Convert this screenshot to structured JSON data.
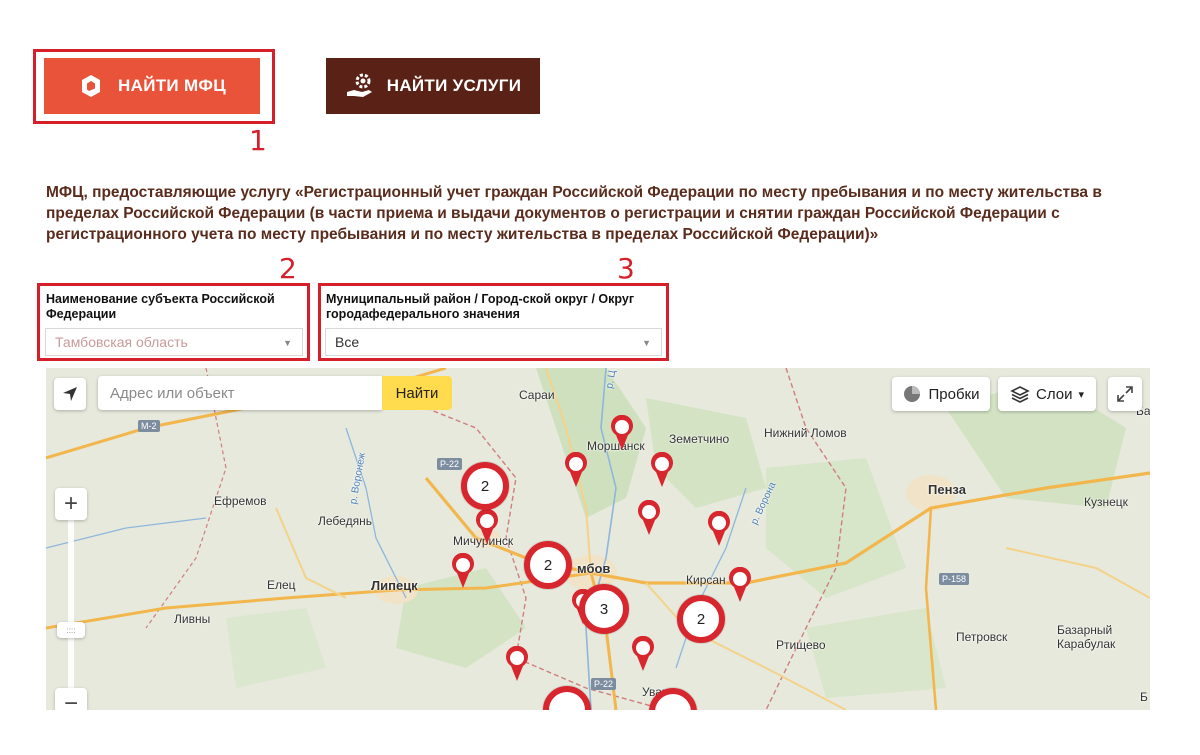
{
  "buttons": {
    "find_mfc": "НАЙТИ МФЦ",
    "find_services": "НАЙТИ УСЛУГИ"
  },
  "annotations": [
    "1",
    "2",
    "3"
  ],
  "description": "МФЦ, предоставляющие услугу «Регистрационный учет граждан Российской Федерации по месту пребывания и по месту жительства в пределах Российской Федерации (в части приема и выдачи документов о регистрации и снятии граждан Российской Федерации с регистрационного учета по месту пребывания и по месту жительства в пределах Российской Федерации)»",
  "filters": {
    "region": {
      "label": "Наименование субъекта Российской Федерации",
      "value": "Тамбовская область"
    },
    "district": {
      "label": "Муниципальный район / Город-ской округ / Округ городафедерального значения",
      "value": "Все"
    }
  },
  "map": {
    "search_placeholder": "Адрес или объект",
    "search_button": "Найти",
    "traffic_label": "Пробки",
    "layers_label": "Слои",
    "zoom_in": "+",
    "zoom_out": "−",
    "places": {
      "sarai": "Сараи",
      "morshansk": "Моршанск",
      "zemetchino": "Земетчино",
      "nizhny_lomov": "Нижний Ломов",
      "efremov": "Ефремов",
      "lebedyan": "Лебедянь",
      "michurinsk": "Мичуринск",
      "penza": "Пенза",
      "kuznetsk": "Кузнецк",
      "tambov": "мбов",
      "kirsanov": "Кирсан",
      "elets": "Елец",
      "lipetsk": "Липецк",
      "livny": "Ливны",
      "petrovsk": "Петровск",
      "bazarny_karabulak": "Базарный Карабулак",
      "rtishchevo": "Ртищево",
      "uvarovo": "Уваро",
      "edge_b1": "Ба",
      "edge_b2": "Б"
    },
    "roads": {
      "m2": "М-2",
      "r22a": "Р-22",
      "r158": "Р-158",
      "r22b": "Р-22"
    },
    "rivers": {
      "tsna": "р. Ц",
      "voronezh": "р. Воронеж",
      "vorona": "р. Ворона"
    },
    "clusters": [
      "2",
      "2",
      "3",
      "2"
    ]
  },
  "colors": {
    "accent_red": "#e8533a",
    "dark_brown": "#5a2216",
    "highlight": "#d51f2b",
    "marker": "#d8262f",
    "search_button": "#ffdb4d"
  }
}
